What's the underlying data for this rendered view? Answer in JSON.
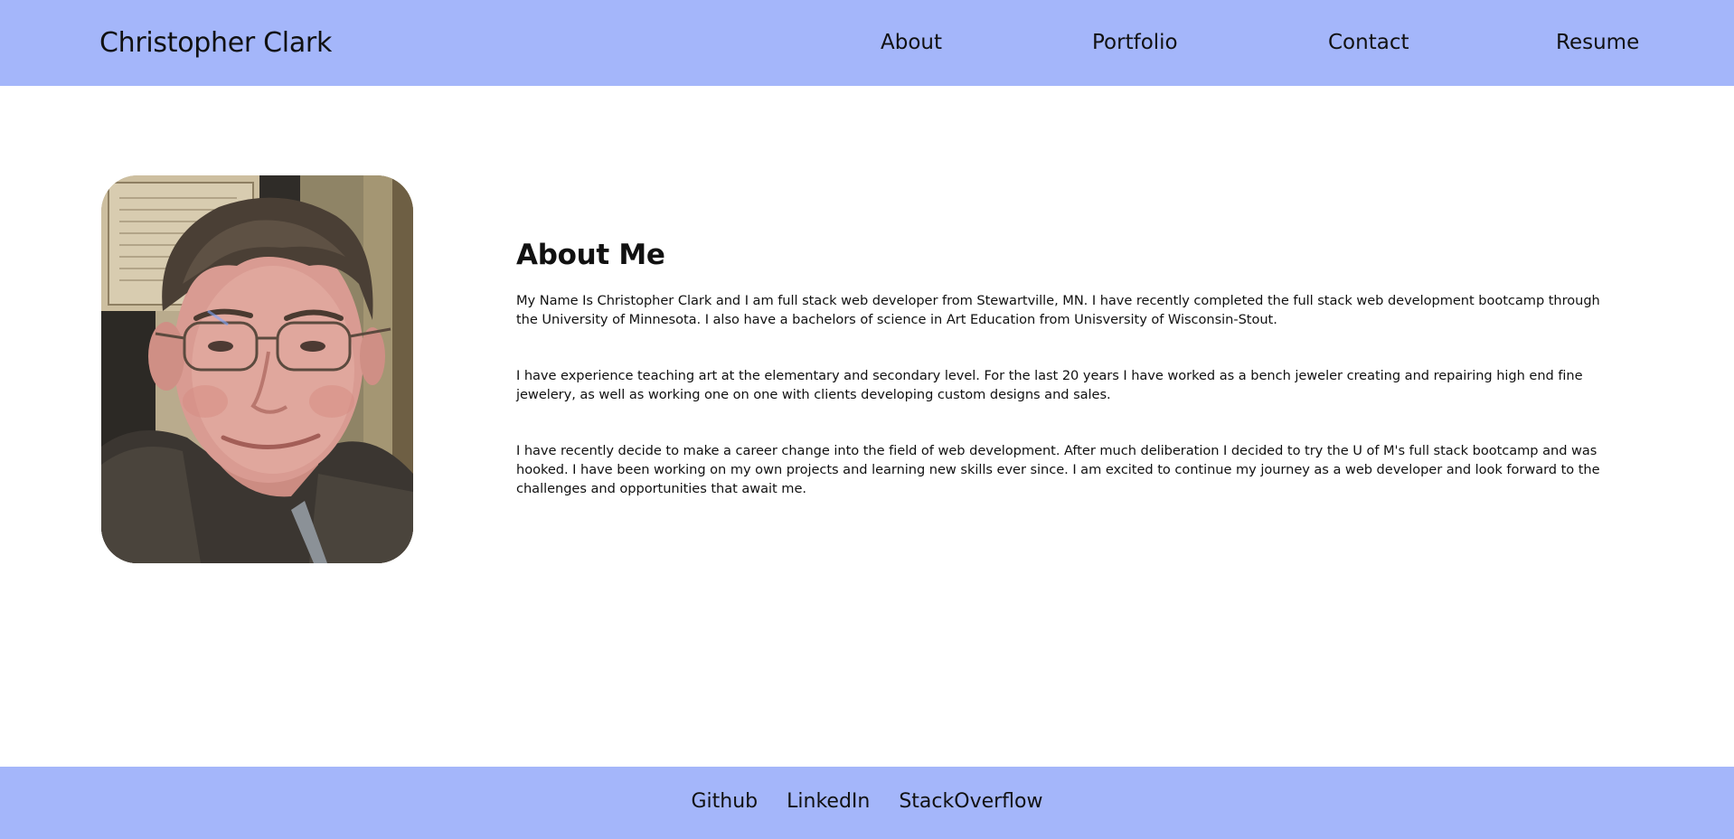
{
  "header": {
    "site_title": "Christopher Clark",
    "nav": {
      "about": "About",
      "portfolio": "Portfolio",
      "contact": "Contact",
      "resume": "Resume"
    }
  },
  "main": {
    "photo_icon": "profile-photo",
    "heading": "About Me",
    "paragraphs": [
      "My Name Is Christopher Clark and I am full stack web developer from Stewartville, MN. I have recently completed the full stack web development bootcamp through the University of Minnesota. I also have a bachelors of science in Art Education from Unisversity of Wisconsin-Stout.",
      "I have experience teaching art at the elementary and secondary level. For the last 20 years I have worked as a bench jeweler creating and repairing high end fine jewelery, as well as working one on one with clients developing custom designs and sales.",
      "I have recently decide to make a career change into the field of web development. After much deliberation I decided to try the U of M's full stack bootcamp and was hooked. I have been working on my own projects and learning new skills ever since. I am excited to continue my journey as a web developer and look forward to the challenges and opportunities that await me."
    ]
  },
  "footer": {
    "links": {
      "github": "Github",
      "linkedin": "LinkedIn",
      "stackoverflow": "StackOverflow"
    }
  },
  "colors": {
    "header_bg": "#a4b6fa",
    "footer_bg": "#a4b6fa",
    "text": "#111111",
    "page_bg": "#ffffff"
  }
}
